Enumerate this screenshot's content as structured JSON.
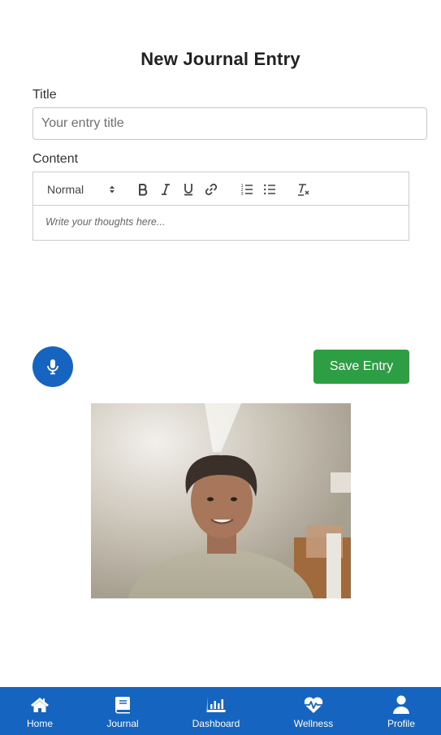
{
  "page": {
    "title": "New Journal Entry"
  },
  "form": {
    "title_label": "Title",
    "title_placeholder": "Your entry title",
    "title_value": "",
    "content_label": "Content",
    "content_placeholder": "Write your thoughts here..."
  },
  "editor_toolbar": {
    "format_selected": "Normal",
    "buttons": [
      "bold-icon",
      "italic-icon",
      "underline-icon",
      "link-icon",
      "ordered-list-icon",
      "bullet-list-icon",
      "clear-format-icon"
    ]
  },
  "actions": {
    "save_label": "Save Entry",
    "mic_icon": "microphone-icon"
  },
  "camera": {
    "icon": "webcam-preview"
  },
  "bottom_nav": {
    "items": [
      {
        "label": "Home",
        "icon": "home-icon"
      },
      {
        "label": "Journal",
        "icon": "book-icon"
      },
      {
        "label": "Dashboard",
        "icon": "chart-bar-icon"
      },
      {
        "label": "Wellness",
        "icon": "heartbeat-icon"
      },
      {
        "label": "Profile",
        "icon": "user-icon"
      }
    ]
  },
  "colors": {
    "primary": "#1565c0",
    "save": "#2e9e44",
    "nav_text": "#ffffff"
  }
}
